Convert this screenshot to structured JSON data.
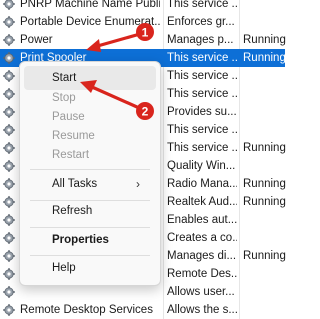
{
  "colors": {
    "selection": "#0d6fd6",
    "annotation": "#d9251d"
  },
  "services": [
    {
      "name": "PNRP Machine Name Publi...",
      "description": "This service ...",
      "status": ""
    },
    {
      "name": "Portable Device Enumerat...",
      "description": "Enforces gr...",
      "status": ""
    },
    {
      "name": "Power",
      "description": "Manages p...",
      "status": "Running"
    },
    {
      "name": "Print Spooler",
      "description": "This service ...",
      "status": "Running",
      "selected": true
    },
    {
      "name": "",
      "description": "This service ...",
      "status": ""
    },
    {
      "name": "",
      "description": "This service ...",
      "status": ""
    },
    {
      "name": "",
      "description": "Provides su...",
      "status": ""
    },
    {
      "name": "",
      "description": "This service ...",
      "status": ""
    },
    {
      "name": "",
      "description": "This service ...",
      "status": "Running"
    },
    {
      "name": "",
      "description": "Quality Win...",
      "status": ""
    },
    {
      "name": "",
      "description": "Radio Mana...",
      "status": "Running"
    },
    {
      "name": "",
      "description": "Realtek Aud...",
      "status": "Running"
    },
    {
      "name": "",
      "description": "Enables aut...",
      "status": ""
    },
    {
      "name": "",
      "description": "Creates a co...",
      "status": ""
    },
    {
      "name": "",
      "description": "Manages di...",
      "status": "Running"
    },
    {
      "name": "",
      "description": "Remote Des...",
      "status": ""
    },
    {
      "name": "",
      "description": "Allows user...",
      "status": ""
    },
    {
      "name": "Remote Desktop Services",
      "description": "Allows the s...",
      "status": ""
    }
  ],
  "context_menu": {
    "start": "Start",
    "stop": "Stop",
    "pause": "Pause",
    "resume": "Resume",
    "restart": "Restart",
    "all_tasks": "All Tasks",
    "refresh": "Refresh",
    "properties": "Properties",
    "help": "Help"
  },
  "annotations": {
    "badge_1": "1",
    "badge_2": "2"
  }
}
